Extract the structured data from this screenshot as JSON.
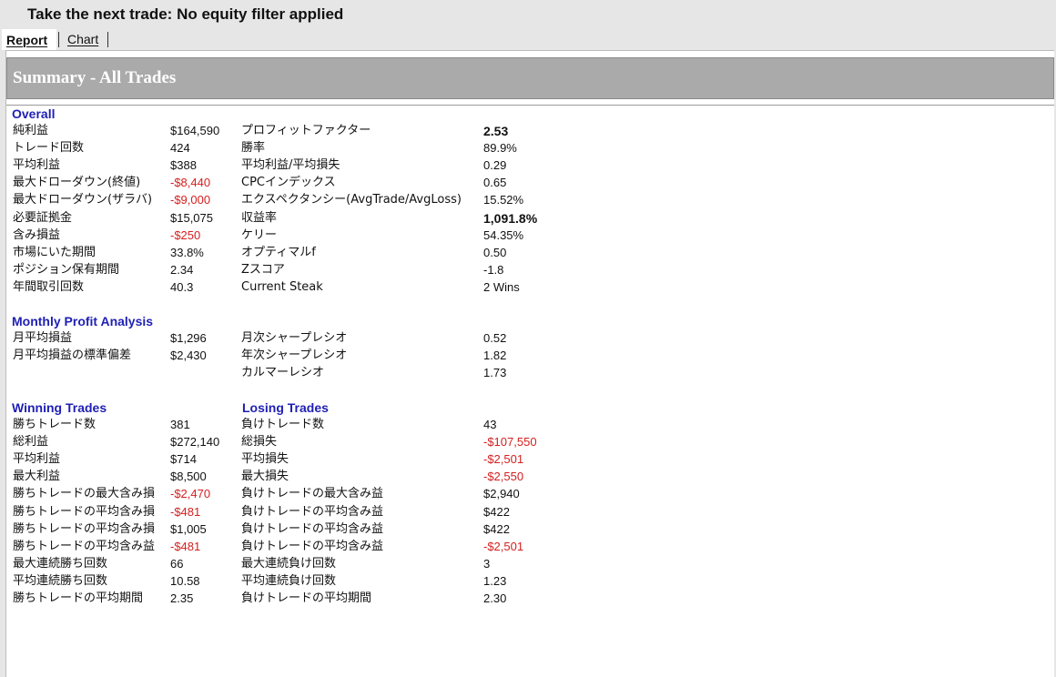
{
  "window": {
    "title": "Take the next trade: No equity filter applied"
  },
  "tabs": [
    {
      "label": "Report"
    },
    {
      "label": "Chart"
    }
  ],
  "summary": {
    "title": "Summary - All Trades"
  },
  "overall": {
    "heading": "Overall",
    "left": [
      {
        "label": "純利益",
        "value": "$164,590"
      },
      {
        "label": "トレード回数",
        "value": "424"
      },
      {
        "label": "平均利益",
        "value": "$388"
      },
      {
        "label": "最大ドローダウン(終値)",
        "value": "-$8,440"
      },
      {
        "label": "最大ドローダウン(ザラバ)",
        "value": "-$9,000"
      },
      {
        "label": "必要証拠金",
        "value": "$15,075"
      },
      {
        "label": "含み損益",
        "value": "-$250"
      },
      {
        "label": "市場にいた期間",
        "value": "33.8%"
      },
      {
        "label": "ポジション保有期間",
        "value": "2.34"
      },
      {
        "label": "年間取引回数",
        "value": "40.3"
      }
    ],
    "right": [
      {
        "label": "プロフィットファクター",
        "value": "2.53"
      },
      {
        "label": "勝率",
        "value": "89.9%"
      },
      {
        "label": "平均利益/平均損失",
        "value": "0.29"
      },
      {
        "label": "CPCインデックス",
        "value": "0.65"
      },
      {
        "label": "エクスペクタンシー(AvgTrade/AvgLoss)",
        "value": "15.52%"
      },
      {
        "label": "収益率",
        "value": "1,091.8%"
      },
      {
        "label": "ケリー",
        "value": "54.35%"
      },
      {
        "label": "オプティマルf",
        "value": "0.50"
      },
      {
        "label": "Zスコア",
        "value": "-1.8"
      },
      {
        "label": "Current Steak",
        "value": "2 Wins"
      }
    ]
  },
  "monthly": {
    "heading": "Monthly Profit Analysis",
    "left": [
      {
        "label": "月平均損益",
        "value": "$1,296"
      },
      {
        "label": "月平均損益の標準偏差",
        "value": "$2,430"
      }
    ],
    "right": [
      {
        "label": "月次シャープレシオ",
        "value": "0.52"
      },
      {
        "label": "年次シャープレシオ",
        "value": "1.82"
      },
      {
        "label": "カルマーレシオ",
        "value": "1.73"
      }
    ]
  },
  "winning": {
    "heading": "Winning Trades",
    "rows": [
      {
        "label": "勝ちトレード数",
        "value": "381"
      },
      {
        "label": "総利益",
        "value": "$272,140"
      },
      {
        "label": "平均利益",
        "value": "$714"
      },
      {
        "label": "最大利益",
        "value": "$8,500"
      },
      {
        "label": "勝ちトレードの最大含み損",
        "value": "-$2,470"
      },
      {
        "label": "勝ちトレードの平均含み損",
        "value": "-$481"
      },
      {
        "label": "勝ちトレードの平均含み損",
        "value": "$1,005"
      },
      {
        "label": "勝ちトレードの平均含み益",
        "value": "-$481"
      },
      {
        "label": "最大連続勝ち回数",
        "value": "66"
      },
      {
        "label": "平均連続勝ち回数",
        "value": "10.58"
      },
      {
        "label": "勝ちトレードの平均期間",
        "value": "2.35"
      }
    ]
  },
  "losing": {
    "heading": "Losing Trades",
    "rows": [
      {
        "label": "負けトレード数",
        "value": "43"
      },
      {
        "label": "総損失",
        "value": "-$107,550"
      },
      {
        "label": "平均損失",
        "value": "-$2,501"
      },
      {
        "label": "最大損失",
        "value": "-$2,550"
      },
      {
        "label": "負けトレードの最大含み益",
        "value": "$2,940"
      },
      {
        "label": "負けトレードの平均含み益",
        "value": "$422"
      },
      {
        "label": "負けトレードの平均含み益",
        "value": "$422"
      },
      {
        "label": "負けトレードの平均含み益",
        "value": "-$2,501"
      },
      {
        "label": "最大連続負け回数",
        "value": "3"
      },
      {
        "label": "平均連続負け回数",
        "value": "1.23"
      },
      {
        "label": "負けトレードの平均期間",
        "value": "2.30"
      }
    ]
  },
  "colors": {
    "negative": "#d42020",
    "heading": "#1f1fb4",
    "header_bar": "#aaaaaa"
  }
}
